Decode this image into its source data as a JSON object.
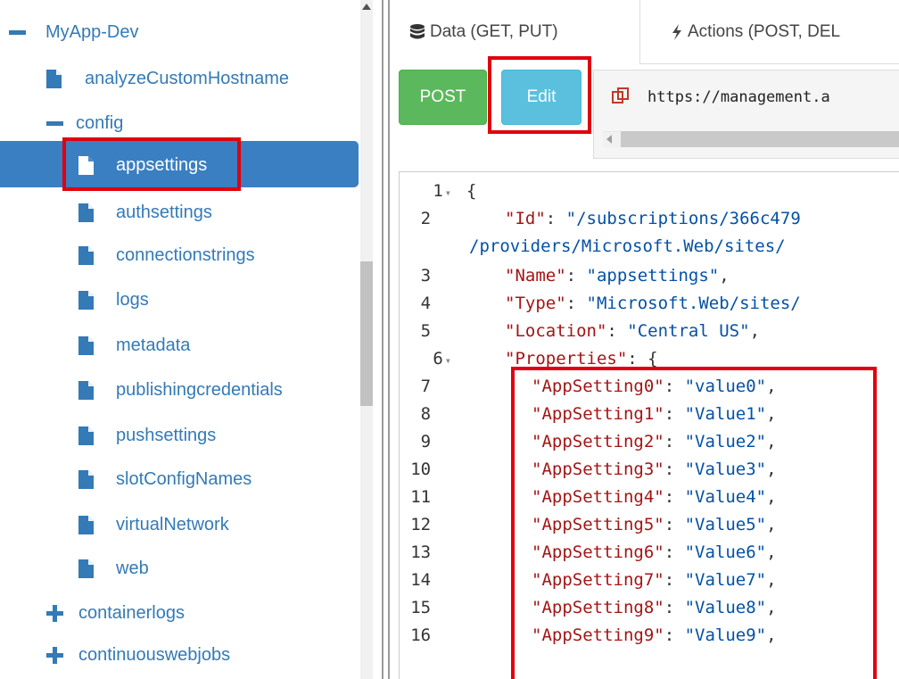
{
  "tree": {
    "root_label": "MyApp-Dev",
    "items": [
      {
        "label": "analyzeCustomHostname"
      },
      {
        "label": "config"
      },
      {
        "label": "appsettings"
      },
      {
        "label": "authsettings"
      },
      {
        "label": "connectionstrings"
      },
      {
        "label": "logs"
      },
      {
        "label": "metadata"
      },
      {
        "label": "publishingcredentials"
      },
      {
        "label": "pushsettings"
      },
      {
        "label": "slotConfigNames"
      },
      {
        "label": "virtualNetwork"
      },
      {
        "label": "web"
      },
      {
        "label": "containerlogs"
      },
      {
        "label": "continuouswebjobs"
      }
    ]
  },
  "tabs": {
    "data_label": "Data (GET, PUT)",
    "actions_label": "Actions (POST, DEL"
  },
  "toolbar": {
    "post_label": "POST",
    "edit_label": "Edit",
    "url": "https://management.a"
  },
  "editor": {
    "lines": [
      {
        "num": "1",
        "text": "{"
      },
      {
        "num": "2",
        "key": "\"Id\"",
        "value": "\"/subscriptions/366c479"
      },
      {
        "num": "",
        "value": "/providers/Microsoft.Web/sites/"
      },
      {
        "num": "3",
        "key": "\"Name\"",
        "value": "\"appsettings\""
      },
      {
        "num": "4",
        "key": "\"Type\"",
        "value": "\"Microsoft.Web/sites/"
      },
      {
        "num": "5",
        "key": "\"Location\"",
        "value": "\"Central US\""
      },
      {
        "num": "6",
        "key": "\"Properties\"",
        "text": "{"
      },
      {
        "num": "7",
        "key": "\"AppSetting0\"",
        "value": "\"value0\""
      },
      {
        "num": "8",
        "key": "\"AppSetting1\"",
        "value": "\"Value1\""
      },
      {
        "num": "9",
        "key": "\"AppSetting2\"",
        "value": "\"Value2\""
      },
      {
        "num": "10",
        "key": "\"AppSetting3\"",
        "value": "\"Value3\""
      },
      {
        "num": "11",
        "key": "\"AppSetting4\"",
        "value": "\"Value4\""
      },
      {
        "num": "12",
        "key": "\"AppSetting5\"",
        "value": "\"Value5\""
      },
      {
        "num": "13",
        "key": "\"AppSetting6\"",
        "value": "\"Value6\""
      },
      {
        "num": "14",
        "key": "\"AppSetting7\"",
        "value": "\"Value7\""
      },
      {
        "num": "15",
        "key": "\"AppSetting8\"",
        "value": "\"Value8\""
      },
      {
        "num": "16",
        "key": "\"AppSetting9\"",
        "value": "\"Value9\""
      }
    ]
  },
  "colors": {
    "link": "#337ab7",
    "selected_bg": "#3a7fc2",
    "post_button": "#5cb85c",
    "edit_button": "#5bc0de",
    "highlight_box": "#e0000f",
    "json_key": "#a31515",
    "json_string": "#0451a5"
  },
  "icons": {
    "expanded": "minus-icon",
    "collapsed": "plus-icon",
    "file": "file-icon",
    "data_tab": "database-icon",
    "actions_tab": "bolt-icon",
    "url": "copy-icon"
  }
}
